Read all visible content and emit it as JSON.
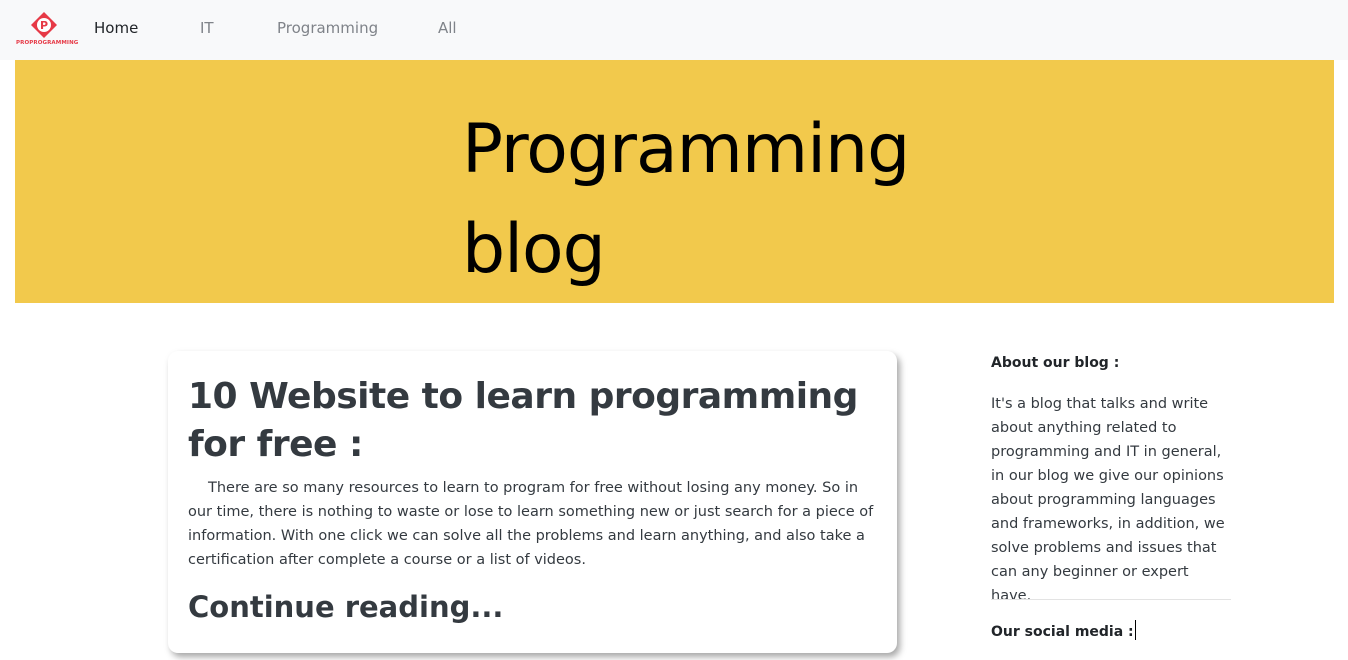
{
  "brand": {
    "logo_text": "PROPROGRAMMING",
    "logo_letter": "P",
    "accent": "#e63946"
  },
  "nav": {
    "items": [
      {
        "label": "Home",
        "active": true
      },
      {
        "label": "IT",
        "active": false
      },
      {
        "label": "Programming",
        "active": false
      },
      {
        "label": "All",
        "active": false
      }
    ]
  },
  "hero": {
    "title_line1": "Programming",
    "title_line2": "blog",
    "background": "#f2c94c"
  },
  "post": {
    "title": "10 Website to learn programming for free :",
    "excerpt": "There are so many resources to learn to program for free without losing any money. So in our time, there is nothing to waste or lose to learn something new or just search for a piece of information. With one click we can solve all the problems and learn anything, and also take a certification after complete a course or a list of videos.",
    "link_label": "Continue reading..."
  },
  "sidebar": {
    "about_heading": "About our blog :",
    "about_text": "It's a blog that talks and write about anything related to programming and IT in general, in our blog we give our opinions about programming languages and frameworks, in addition, we solve problems and issues that can any beginner or expert have.",
    "social_heading": "Our social media :"
  }
}
